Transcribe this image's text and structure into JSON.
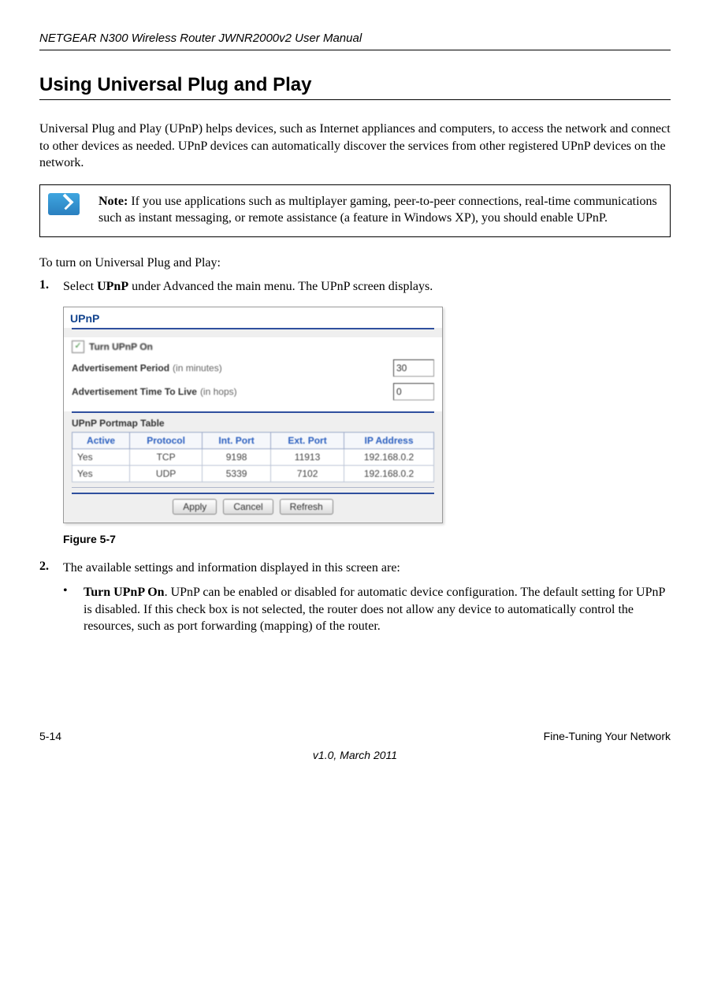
{
  "header": {
    "product_title": "NETGEAR N300 Wireless Router JWNR2000v2 User Manual"
  },
  "section": {
    "title": "Using Universal Plug and Play",
    "intro_para": "Universal Plug and Play (UPnP) helps devices, such as Internet appliances and computers, to access the network and connect to other devices as needed. UPnP devices can automatically discover the services from other registered UPnP devices on the network."
  },
  "note": {
    "label": "Note:",
    "body": " If you use applications such as multiplayer gaming, peer-to-peer connections, real-time communications such as instant messaging, or remote assistance (a feature in Windows XP), you should enable UPnP."
  },
  "steps": {
    "lead_in": "To turn on Universal Plug and Play:",
    "step1_num": "1.",
    "step1_a": "Select ",
    "step1_b": "UPnP",
    "step1_c": " under Advanced the main menu. The UPnP screen displays.",
    "step2_num": "2.",
    "step2_text": "The available settings and information displayed in this screen are:"
  },
  "upnp_panel": {
    "title": "UPnP",
    "checkbox_label": "Turn UPnP On",
    "checkbox_checked": true,
    "adv_period_label": "Advertisement Period",
    "adv_period_hint": "(in minutes)",
    "adv_period_value": "30",
    "adv_ttl_label": "Advertisement Time To Live",
    "adv_ttl_hint": "(in hops)",
    "adv_ttl_value": "0",
    "portmap_heading": "UPnP Portmap Table",
    "columns": [
      "Active",
      "Protocol",
      "Int. Port",
      "Ext. Port",
      "IP Address"
    ],
    "rows": [
      {
        "active": "Yes",
        "protocol": "TCP",
        "int_port": "9198",
        "ext_port": "11913",
        "ip": "192.168.0.2"
      },
      {
        "active": "Yes",
        "protocol": "UDP",
        "int_port": "5339",
        "ext_port": "7102",
        "ip": "192.168.0.2"
      }
    ],
    "buttons": {
      "apply": "Apply",
      "cancel": "Cancel",
      "refresh": "Refresh"
    }
  },
  "figure_caption": "Figure 5-7",
  "bullet": {
    "title": "Turn UPnP On",
    "rest": ". UPnP can be enabled or disabled for automatic device configuration. The default setting for UPnP is disabled. If this check box is not selected, the router does not allow any device to automatically control the resources, such as port forwarding (mapping) of the router."
  },
  "footer": {
    "page_num": "5-14",
    "section_name": "Fine-Tuning Your Network",
    "version": "v1.0, March 2011"
  }
}
